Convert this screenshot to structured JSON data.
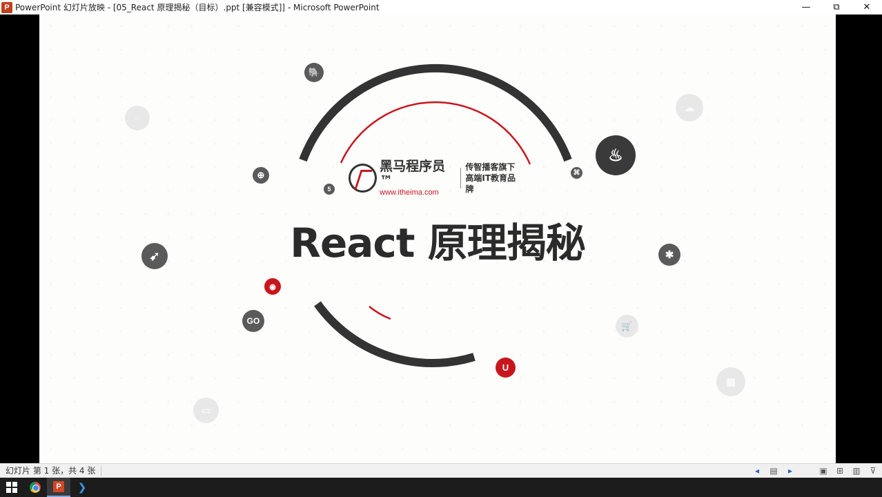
{
  "window": {
    "app_icon_letter": "P",
    "title": "PowerPoint 幻灯片放映 - [05_React 原理揭秘（目标）.ppt [兼容模式]] - Microsoft PowerPoint",
    "controls": {
      "minimize": "—",
      "restore": "⧉",
      "close": "✕"
    }
  },
  "slide": {
    "logo": {
      "brand_name": "黑马程序员™",
      "url": "www.itheima.com",
      "tagline_1": "传智播客旗下",
      "tagline_2": "高端IT教育品牌"
    },
    "title": "React 原理揭秘",
    "icon_badges": {
      "go": "GO",
      "java": "♨",
      "php": "🐘",
      "globe": "⊕",
      "html5": "5",
      "python": "⌘",
      "bird": "➹",
      "bug": "✱",
      "user": "◉",
      "ui": "U",
      "cart": "🛒",
      "cloud": "☁",
      "store": "▦",
      "window": "▭",
      "ghost_top_left": "◌"
    },
    "colors": {
      "ring_dark": "#333333",
      "ring_red": "#c8161d",
      "background": "#fdfdfc"
    }
  },
  "statusbar": {
    "slide_info": "幻灯片 第 1 张，共 4 张"
  },
  "taskbar": {
    "apps": [
      "start",
      "chrome",
      "powerpoint",
      "vscode"
    ]
  }
}
